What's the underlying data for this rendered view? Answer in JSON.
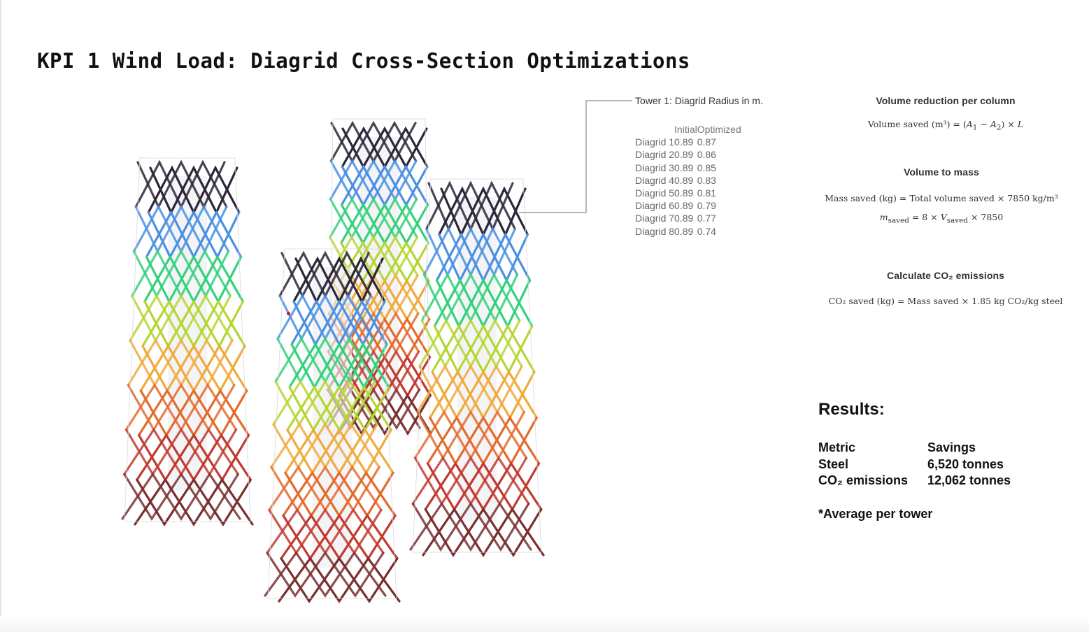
{
  "page": {
    "title": "KPI 1 Wind Load: Diagrid Cross-Section Optimizations"
  },
  "radius_table": {
    "title": "Tower 1: Diagrid Radius in m.",
    "headers": [
      "",
      "Initial",
      "Optimized"
    ],
    "rows": [
      [
        "Diagrid 1",
        "0.89",
        "0.87"
      ],
      [
        "Diagrid 2",
        "0.89",
        "0.86"
      ],
      [
        "Diagrid 3",
        "0.89",
        "0.85"
      ],
      [
        "Diagrid 4",
        "0.89",
        "0.83"
      ],
      [
        "Diagrid 5",
        "0.89",
        "0.81"
      ],
      [
        "Diagrid 6",
        "0.89",
        "0.79"
      ],
      [
        "Diagrid 7",
        "0.89",
        "0.77"
      ],
      [
        "Diagrid 8",
        "0.89",
        "0.74"
      ]
    ]
  },
  "calculations": {
    "volume": {
      "heading": "Volume reduction per column"
    },
    "mass": {
      "heading": "Volume to mass"
    },
    "co2": {
      "heading": "Calculate CO₂ emissions"
    }
  },
  "results": {
    "heading": "Results:",
    "columns": [
      "Metric",
      "Savings"
    ],
    "rows": [
      [
        "Steel",
        "6,520 tonnes"
      ],
      [
        "CO₂ emissions",
        "12,062 tonnes"
      ]
    ],
    "footnote": "*Average per tower"
  },
  "graphic": {
    "band_colors": [
      "#2b2638",
      "#4a90e2",
      "#33d17a",
      "#b5d631",
      "#f0a93a",
      "#e46a2c",
      "#c2392f",
      "#7a2f2f"
    ],
    "band_names": [
      "Diagrid 1",
      "Diagrid 2",
      "Diagrid 3",
      "Diagrid 4",
      "Diagrid 5",
      "Diagrid 6",
      "Diagrid 7",
      "Diagrid 8"
    ],
    "highlight_color": "#e0121b"
  }
}
